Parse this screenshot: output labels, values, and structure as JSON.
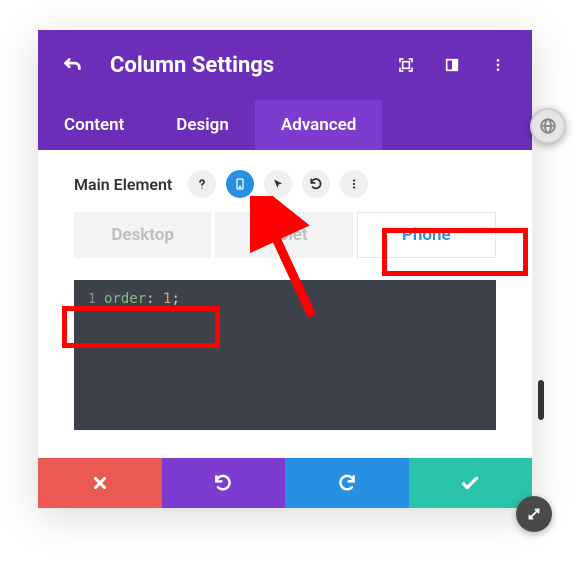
{
  "header": {
    "title": "Column Settings"
  },
  "tabs": {
    "content": "Content",
    "design": "Design",
    "advanced": "Advanced",
    "active": "advanced"
  },
  "section": {
    "label": "Main Element"
  },
  "devices": {
    "desktop": "Desktop",
    "tablet": "Tablet",
    "phone": "Phone",
    "active": "phone"
  },
  "code": {
    "line_number": "1",
    "property": "order",
    "colon": ":",
    "value": "1",
    "semi": ";"
  }
}
